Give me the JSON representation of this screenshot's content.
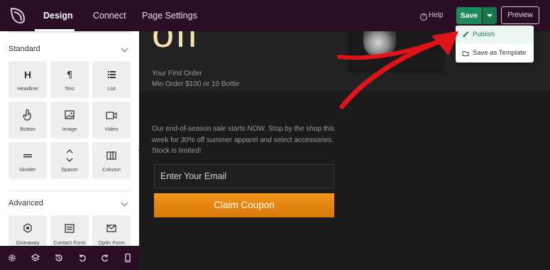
{
  "topbar": {
    "tabs": [
      "Design",
      "Connect",
      "Page Settings"
    ],
    "help_label": "Help",
    "save_label": "Save",
    "preview_label": "Preview"
  },
  "save_menu": {
    "items": [
      "Publish",
      "Save as Template"
    ]
  },
  "sidebar": {
    "standard_label": "Standard",
    "advanced_label": "Advanced",
    "standard_items": [
      "Headline",
      "Text",
      "List",
      "Button",
      "Image",
      "Video",
      "Divider",
      "Spacer",
      "Column"
    ],
    "advanced_items": [
      "Giveaway",
      "Contact Form",
      "Optin Form"
    ]
  },
  "canvas": {
    "headline_fragment": "off",
    "hero_line1": "Your First Order",
    "hero_line2": "Min Order $100 or 10 Bottle",
    "body_text": "Our end-of-season sale starts NOW. Stop by the shop this week for 30% off summer apparel and select accessories. Stock is limited!",
    "email_placeholder": "Enter Your Email",
    "cta_label": "Claim Coupon"
  },
  "colors": {
    "topbar_bg": "#2b0e26",
    "save_green": "#1d8a59",
    "cta_orange": "#f3941b",
    "annotation_red": "#e0131b"
  }
}
